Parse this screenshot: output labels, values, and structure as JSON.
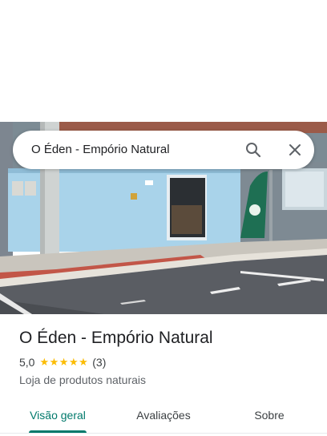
{
  "search": {
    "query": "O Éden - Empório Natural",
    "search_icon": "search-icon",
    "close_icon": "close-icon"
  },
  "place": {
    "name": "O Éden - Empório Natural",
    "rating": "5,0",
    "rating_stars": 5,
    "review_count": "(3)",
    "category": "Loja de produtos naturais"
  },
  "tabs": [
    {
      "label": "Visão geral",
      "selected": true
    },
    {
      "label": "Avaliações",
      "selected": false
    },
    {
      "label": "Sobre",
      "selected": false
    }
  ],
  "colors": {
    "accent": "#00796b",
    "star": "#fbbc04",
    "wall": "#a9d3ea",
    "road": "#5a5d63"
  }
}
